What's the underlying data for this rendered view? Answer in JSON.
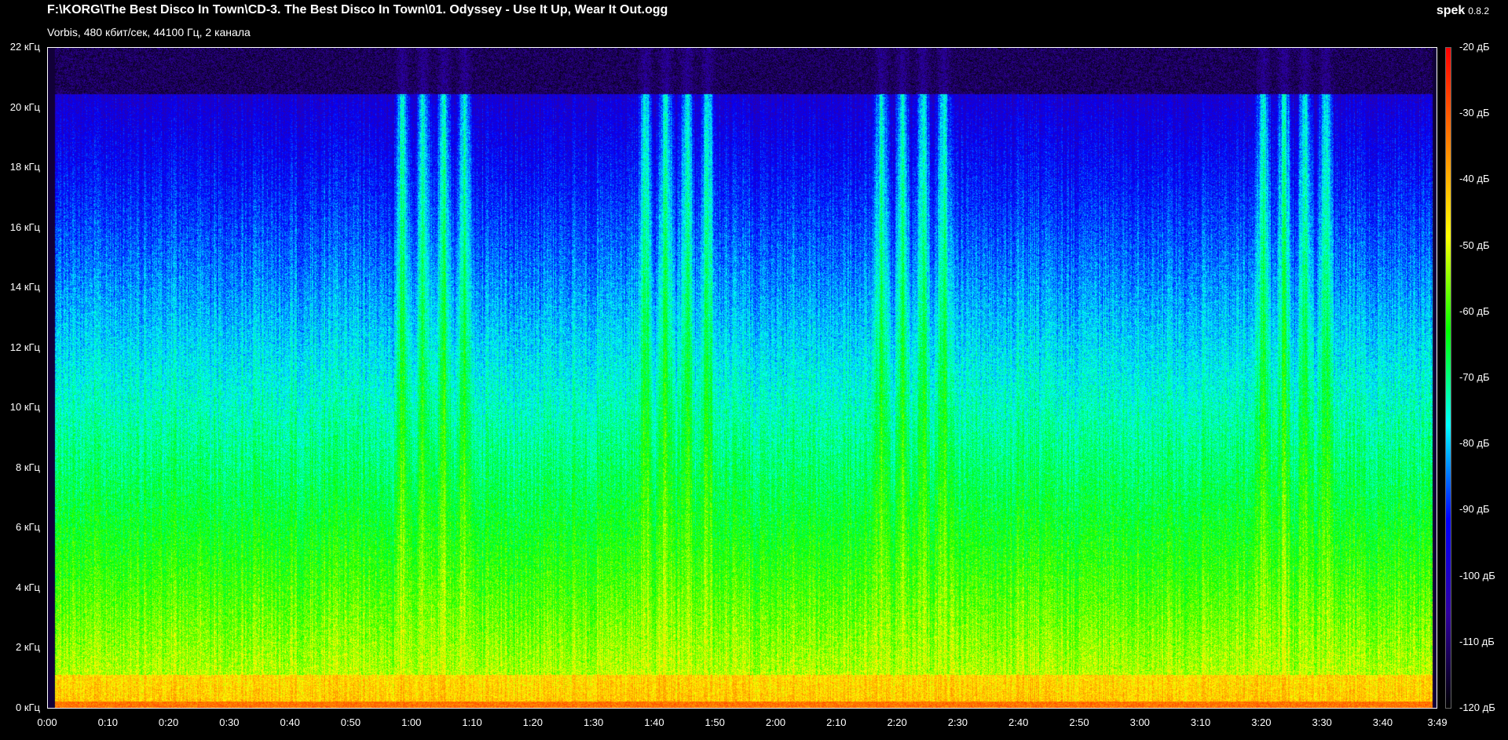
{
  "window": {
    "title": "F:\\KORG\\The Best Disco In Town\\CD-3. The Best Disco In Town\\01. Odyssey - Use It Up, Wear It Out.ogg",
    "subtitle": "Vorbis, 480 кбит/сек, 44100 Гц, 2 канала",
    "app_name": "spek",
    "app_version": "0.8.2"
  },
  "spectrogram": {
    "freq_ticks": [
      "22 кГц",
      "20 кГц",
      "18 кГц",
      "16 кГц",
      "14 кГц",
      "12 кГц",
      "10 кГц",
      "8 кГц",
      "6 кГц",
      "4 кГц",
      "2 кГц",
      "0 кГц"
    ],
    "time_ticks": [
      "0:00",
      "0:10",
      "0:20",
      "0:30",
      "0:40",
      "0:50",
      "1:00",
      "1:10",
      "1:20",
      "1:30",
      "1:40",
      "1:50",
      "2:00",
      "2:10",
      "2:20",
      "2:30",
      "2:40",
      "2:50",
      "3:00",
      "3:10",
      "3:20",
      "3:30",
      "3:40",
      "3:49"
    ],
    "db_ticks": [
      "-20 дБ",
      "-30 дБ",
      "-40 дБ",
      "-50 дБ",
      "-60 дБ",
      "-70 дБ",
      "-80 дБ",
      "-90 дБ",
      "-100 дБ",
      "-110 дБ",
      "-120 дБ"
    ]
  },
  "colors": {
    "background": "#000000",
    "colormap": [
      "#ff0000",
      "#ff8000",
      "#ffff00",
      "#00ff00",
      "#00ffff",
      "#0000ff",
      "#3000a0",
      "#000000"
    ]
  }
}
